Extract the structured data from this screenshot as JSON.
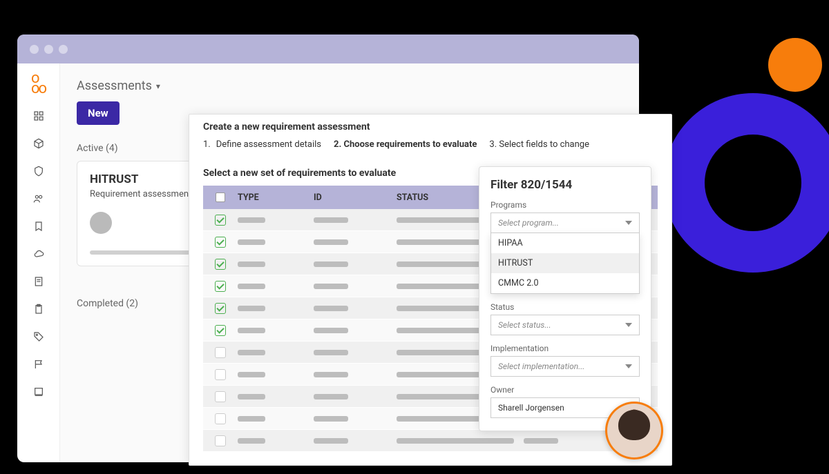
{
  "page": {
    "title": "Assessments",
    "new_button": "New",
    "active_label": "Active (4)",
    "completed_label": "Completed (2)"
  },
  "card": {
    "title": "HITRUST",
    "subtitle": "Requirement assessment"
  },
  "dialog": {
    "title": "Create a new requirement assessment",
    "step1_num": "1.",
    "step1": "Define assessment details",
    "step2": "2. Choose requirements to evaluate",
    "step3": "3. Select fields to change",
    "select_label": "Select a new set of requirements to evaluate",
    "columns": {
      "type": "TYPE",
      "id": "ID",
      "status": "STATUS"
    },
    "rows": [
      {
        "checked": true
      },
      {
        "checked": true
      },
      {
        "checked": true
      },
      {
        "checked": true
      },
      {
        "checked": true
      },
      {
        "checked": true
      },
      {
        "checked": false
      },
      {
        "checked": false
      },
      {
        "checked": false
      },
      {
        "checked": false
      },
      {
        "checked": false
      }
    ]
  },
  "filter": {
    "title": "Filter 820/1544",
    "programs_label": "Programs",
    "programs_placeholder": "Select program...",
    "program_options": [
      "HIPAA",
      "HITRUST",
      "CMMC 2.0"
    ],
    "status_label": "Status",
    "status_placeholder": "Select status...",
    "implementation_label": "Implementation",
    "implementation_placeholder": "Select implementation...",
    "owner_label": "Owner",
    "owner_value": "Sharell Jorgensen"
  }
}
